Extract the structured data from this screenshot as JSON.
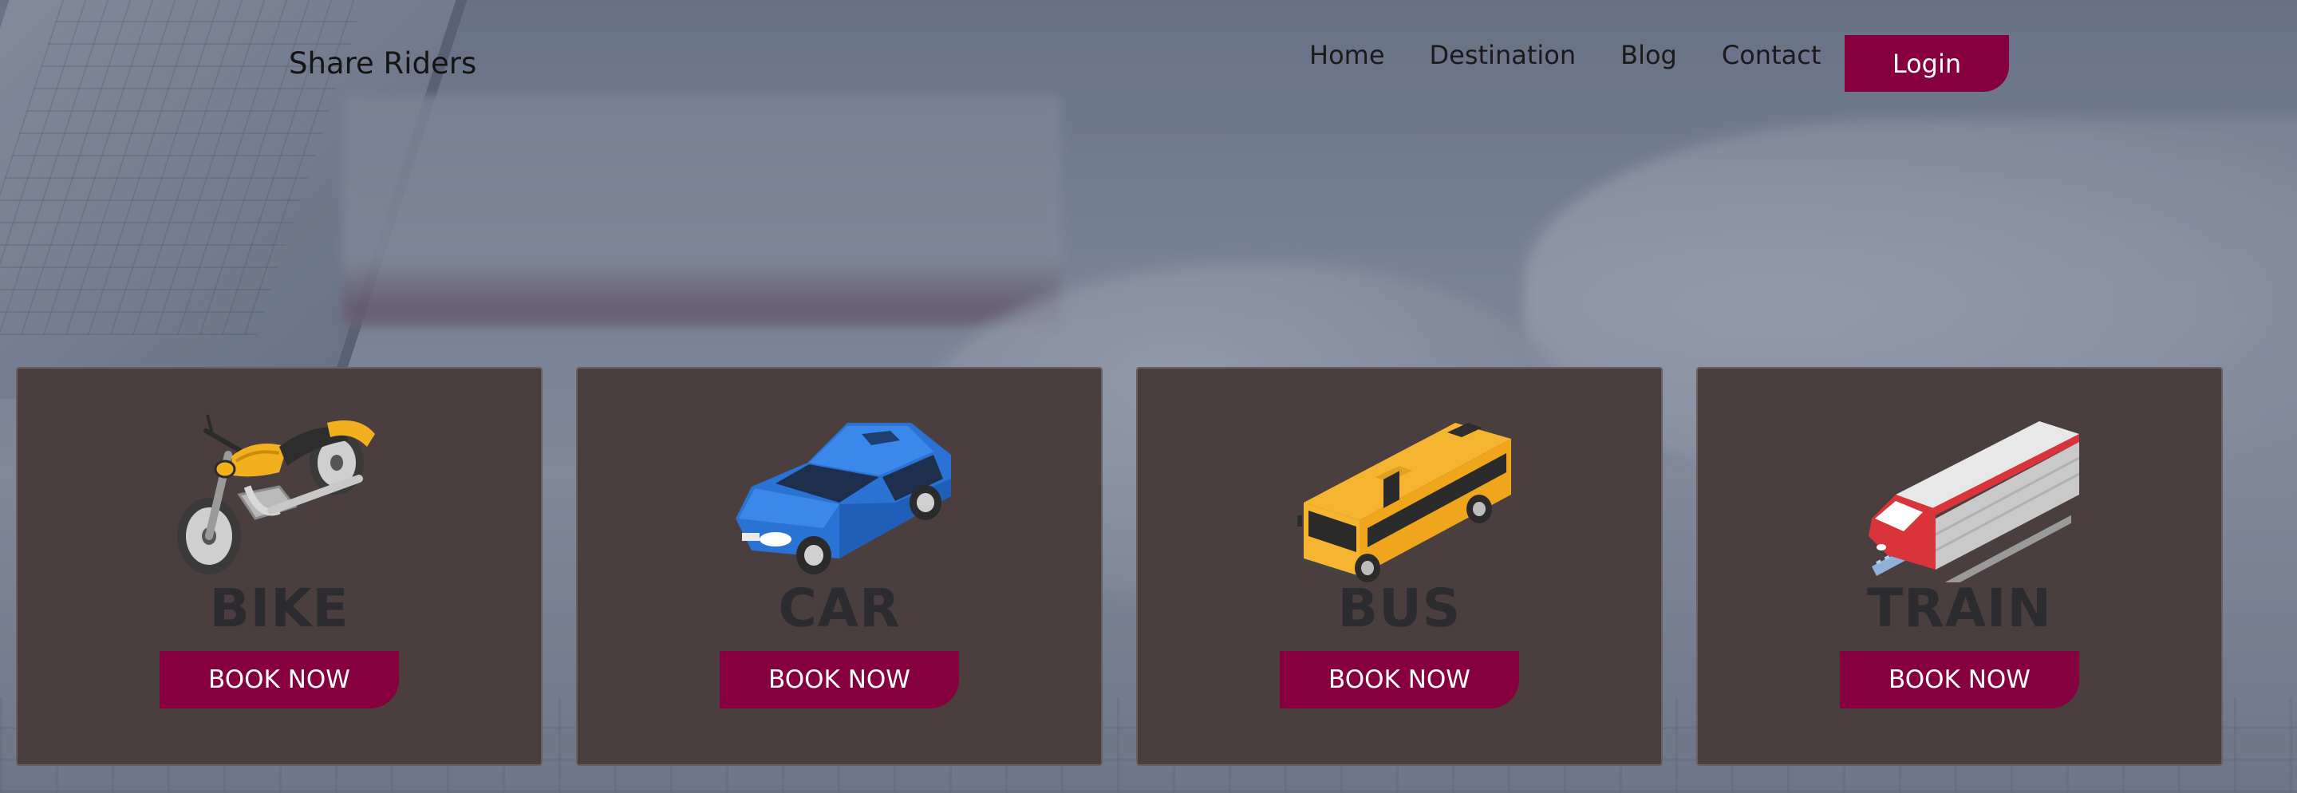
{
  "header": {
    "brand": "Share Riders",
    "nav": [
      {
        "label": "Home"
      },
      {
        "label": "Destination"
      },
      {
        "label": "Blog"
      },
      {
        "label": "Contact"
      }
    ],
    "login_label": "Login"
  },
  "cards": [
    {
      "title": "BIKE",
      "icon": "motorcycle-icon",
      "button_label": "BOOK NOW"
    },
    {
      "title": "CAR",
      "icon": "car-icon",
      "button_label": "BOOK NOW"
    },
    {
      "title": "BUS",
      "icon": "bus-icon",
      "button_label": "BOOK NOW"
    },
    {
      "title": "TRAIN",
      "icon": "train-icon",
      "button_label": "BOOK NOW"
    }
  ],
  "colors": {
    "accent": "#860040",
    "card_background": "#4a3e3e",
    "card_title": "#2c2c30"
  }
}
